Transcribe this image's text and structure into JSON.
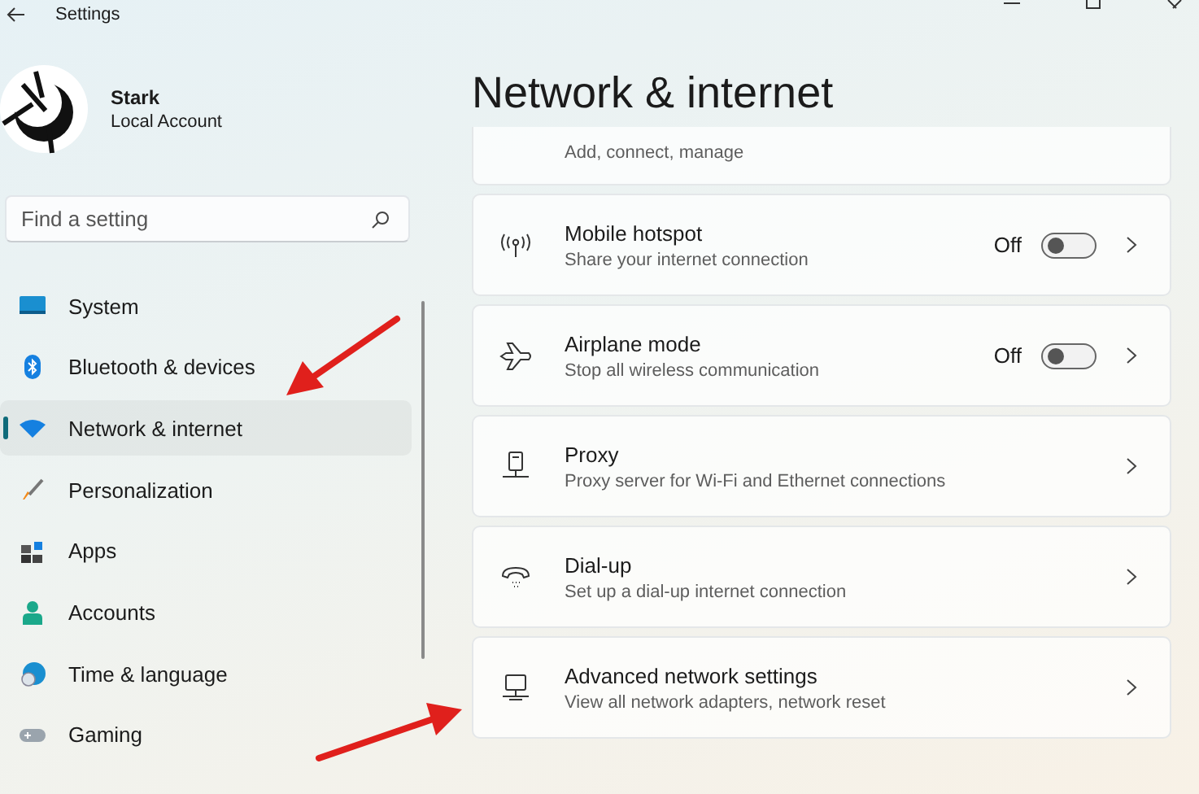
{
  "window": {
    "title": "Settings"
  },
  "profile": {
    "name": "Stark",
    "account_type": "Local Account"
  },
  "search": {
    "placeholder": "Find a setting"
  },
  "sidebar": {
    "items": [
      {
        "label": "System",
        "selected": false
      },
      {
        "label": "Bluetooth & devices",
        "selected": false
      },
      {
        "label": "Network & internet",
        "selected": true
      },
      {
        "label": "Personalization",
        "selected": false
      },
      {
        "label": "Apps",
        "selected": false
      },
      {
        "label": "Accounts",
        "selected": false
      },
      {
        "label": "Time & language",
        "selected": false
      },
      {
        "label": "Gaming",
        "selected": false
      }
    ]
  },
  "page": {
    "title": "Network & internet"
  },
  "settings": [
    {
      "kind": "partial",
      "subtitle": "Add, connect, manage"
    },
    {
      "kind": "toggle",
      "title": "Mobile hotspot",
      "subtitle": "Share your internet connection",
      "state": "Off",
      "on": false
    },
    {
      "kind": "toggle",
      "title": "Airplane mode",
      "subtitle": "Stop all wireless communication",
      "state": "Off",
      "on": false
    },
    {
      "kind": "link",
      "title": "Proxy",
      "subtitle": "Proxy server for Wi-Fi and Ethernet connections"
    },
    {
      "kind": "link",
      "title": "Dial-up",
      "subtitle": "Set up a dial-up internet connection"
    },
    {
      "kind": "link",
      "title": "Advanced network settings",
      "subtitle": "View all network adapters, network reset"
    }
  ]
}
